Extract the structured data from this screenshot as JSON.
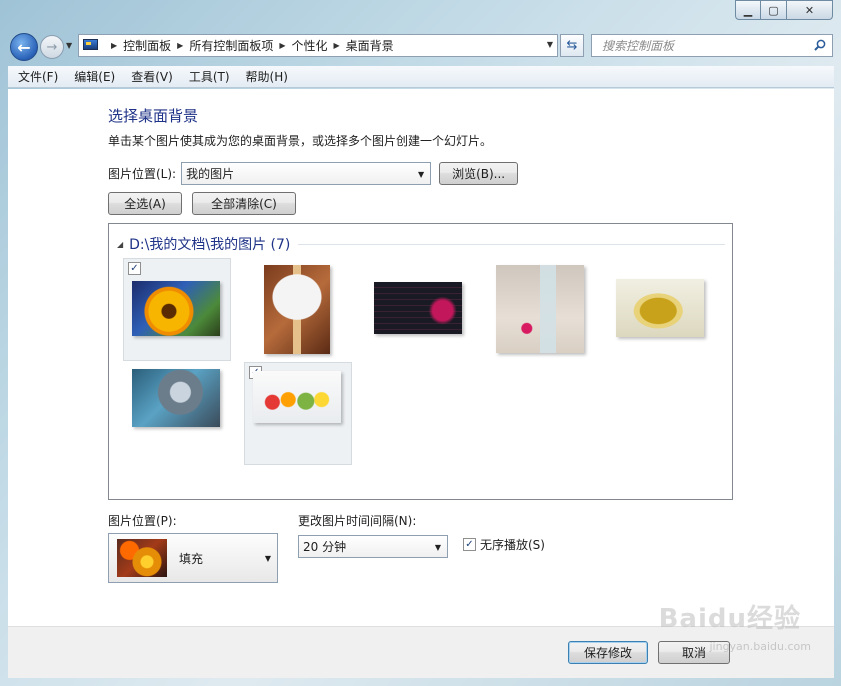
{
  "window": {
    "controls": {
      "minimize": "▁",
      "maximize": "▢",
      "close": "✕"
    }
  },
  "nav": {
    "breadcrumbs": [
      "控制面板",
      "所有控制面板项",
      "个性化",
      "桌面背景"
    ],
    "search_placeholder": "搜索控制面板"
  },
  "menu": [
    "文件(F)",
    "编辑(E)",
    "查看(V)",
    "工具(T)",
    "帮助(H)"
  ],
  "page": {
    "heading": "选择桌面背景",
    "subtitle": "单击某个图片使其成为您的桌面背景，或选择多个图片创建一个幻灯片。",
    "location_label": "图片位置(L):",
    "location_value": "我的图片",
    "browse_label": "浏览(B)...",
    "select_all_label": "全选(A)",
    "clear_all_label": "全部清除(C)"
  },
  "gallery": {
    "group_title": "D:\\我的文档\\我的图片 (7)",
    "images": [
      {
        "subject": "sunflower",
        "checked": true
      },
      {
        "subject": "table-tennis-paddle",
        "checked": false
      },
      {
        "subject": "dark-music-player-screen",
        "checked": false
      },
      {
        "subject": "glass-of-water-with-flower",
        "checked": false
      },
      {
        "subject": "tea-cup",
        "checked": false
      },
      {
        "subject": "armored-game-character",
        "checked": false
      },
      {
        "subject": "fruits-and-vegetables",
        "checked": true
      }
    ]
  },
  "bottom": {
    "position_label": "图片位置(P):",
    "position_value": "填充",
    "interval_label": "更改图片时间间隔(N):",
    "interval_value": "20 分钟",
    "shuffle_label": "无序播放(S)",
    "shuffle_checked": true
  },
  "footer": {
    "save_label": "保存修改",
    "cancel_label": "取消"
  },
  "watermark": {
    "text": "Baidu经验",
    "sub": "jingyan.baidu.com"
  },
  "colors": {
    "heading": "#1e3287",
    "accent": "#2a62b8"
  }
}
